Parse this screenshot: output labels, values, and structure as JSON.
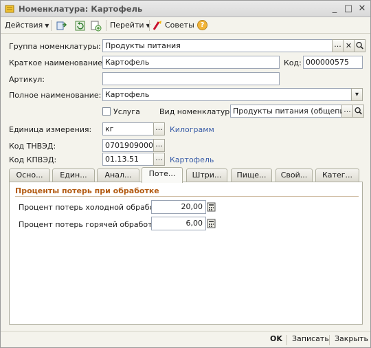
{
  "window": {
    "title": "Номенклатура: Картофель",
    "minimize_glyph": "_",
    "maximize_glyph": "□",
    "close_glyph": "✕"
  },
  "toolbar": {
    "actions_label": "Действия",
    "goto_label": "Перейти",
    "tips_label": "Советы",
    "help_glyph": "?"
  },
  "form": {
    "group_label": "Группа номенклатуры:",
    "group_value": "Продукты питания",
    "short_name_label": "Краткое наименование:",
    "short_name_value": "Картофель",
    "code_label": "Код:",
    "code_value": "000000575",
    "article_label": "Артикул:",
    "article_value": "",
    "full_name_label": "Полное наименование:",
    "full_name_value": "Картофель",
    "service_label": "Услуга",
    "service_checked": false,
    "kind_label": "Вид номенклатуры:",
    "kind_value": "Продукты питания (общепит)",
    "unit_label": "Единица измерения:",
    "unit_value": "кг",
    "unit_link": "Килограмм",
    "tnved_label": "Код ТНВЭД:",
    "tnved_value": "0701909000",
    "kpved_label": "Код КПВЭД:",
    "kpved_value": "01.13.51",
    "kpved_link": "Картофель",
    "ellipsis": "...",
    "clear_glyph": "✕",
    "dropdown_glyph": "▾"
  },
  "tabs": [
    {
      "label": "Осно..."
    },
    {
      "label": "Един..."
    },
    {
      "label": "Анал..."
    },
    {
      "label": "Поте..."
    },
    {
      "label": "Штри..."
    },
    {
      "label": "Пище..."
    },
    {
      "label": "Свой..."
    },
    {
      "label": "Катег..."
    }
  ],
  "active_tab": 3,
  "losses": {
    "section_title": "Проценты потерь при обработке",
    "cold_label": "Процент потерь холодной обработки:",
    "cold_value": "20,00",
    "hot_label": "Процент потерь горячей обработки:",
    "hot_value": "6,00"
  },
  "footer": {
    "ok_label": "OK",
    "save_label": "Записать",
    "close_label": "Закрыть"
  },
  "colors": {
    "link": "#3b5ea8",
    "section_title": "#b35b12"
  }
}
